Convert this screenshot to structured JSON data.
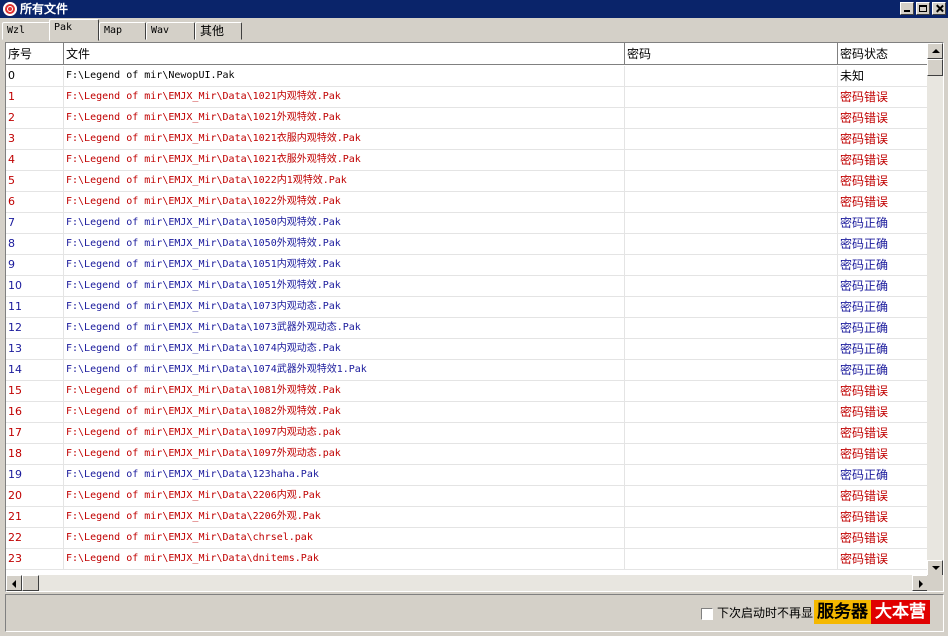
{
  "window": {
    "title": "所有文件"
  },
  "tabs": [
    "Wzl",
    "Pak",
    "Map",
    "Wav",
    "其他"
  ],
  "active_tab": "Pak",
  "table": {
    "columns": [
      "序号",
      "文件",
      "密码",
      "密码状态"
    ],
    "rows": [
      {
        "no": "0",
        "file": "F:\\Legend of mir\\NewopUI.Pak",
        "password": "",
        "status": "未知",
        "color": "black"
      },
      {
        "no": "1",
        "file": "F:\\Legend of mir\\EMJX_Mir\\Data\\1021内观特效.Pak",
        "password": "",
        "status": "密码错误",
        "color": "red"
      },
      {
        "no": "2",
        "file": "F:\\Legend of mir\\EMJX_Mir\\Data\\1021外观特效.Pak",
        "password": "",
        "status": "密码错误",
        "color": "red"
      },
      {
        "no": "3",
        "file": "F:\\Legend of mir\\EMJX_Mir\\Data\\1021衣服内观特效.Pak",
        "password": "",
        "status": "密码错误",
        "color": "red"
      },
      {
        "no": "4",
        "file": "F:\\Legend of mir\\EMJX_Mir\\Data\\1021衣服外观特效.Pak",
        "password": "",
        "status": "密码错误",
        "color": "red"
      },
      {
        "no": "5",
        "file": "F:\\Legend of mir\\EMJX_Mir\\Data\\1022内1观特效.Pak",
        "password": "",
        "status": "密码错误",
        "color": "red"
      },
      {
        "no": "6",
        "file": "F:\\Legend of mir\\EMJX_Mir\\Data\\1022外观特效.Pak",
        "password": "",
        "status": "密码错误",
        "color": "red"
      },
      {
        "no": "7",
        "file": "F:\\Legend of mir\\EMJX_Mir\\Data\\1050内观特效.Pak",
        "password": "",
        "status": "密码正确",
        "color": "blue"
      },
      {
        "no": "8",
        "file": "F:\\Legend of mir\\EMJX_Mir\\Data\\1050外观特效.Pak",
        "password": "",
        "status": "密码正确",
        "color": "blue"
      },
      {
        "no": "9",
        "file": "F:\\Legend of mir\\EMJX_Mir\\Data\\1051内观特效.Pak",
        "password": "",
        "status": "密码正确",
        "color": "blue"
      },
      {
        "no": "10",
        "file": "F:\\Legend of mir\\EMJX_Mir\\Data\\1051外观特效.Pak",
        "password": "",
        "status": "密码正确",
        "color": "blue"
      },
      {
        "no": "11",
        "file": "F:\\Legend of mir\\EMJX_Mir\\Data\\1073内观动态.Pak",
        "password": "",
        "status": "密码正确",
        "color": "blue"
      },
      {
        "no": "12",
        "file": "F:\\Legend of mir\\EMJX_Mir\\Data\\1073武器外观动态.Pak",
        "password": "",
        "status": "密码正确",
        "color": "blue"
      },
      {
        "no": "13",
        "file": "F:\\Legend of mir\\EMJX_Mir\\Data\\1074内观动态.Pak",
        "password": "",
        "status": "密码正确",
        "color": "blue"
      },
      {
        "no": "14",
        "file": "F:\\Legend of mir\\EMJX_Mir\\Data\\1074武器外观特效1.Pak",
        "password": "",
        "status": "密码正确",
        "color": "blue"
      },
      {
        "no": "15",
        "file": "F:\\Legend of mir\\EMJX_Mir\\Data\\1081外观特效.Pak",
        "password": "",
        "status": "密码错误",
        "color": "red"
      },
      {
        "no": "16",
        "file": "F:\\Legend of mir\\EMJX_Mir\\Data\\1082外观特效.Pak",
        "password": "",
        "status": "密码错误",
        "color": "red"
      },
      {
        "no": "17",
        "file": "F:\\Legend of mir\\EMJX_Mir\\Data\\1097内观动态.pak",
        "password": "",
        "status": "密码错误",
        "color": "red"
      },
      {
        "no": "18",
        "file": "F:\\Legend of mir\\EMJX_Mir\\Data\\1097外观动态.pak",
        "password": "",
        "status": "密码错误",
        "color": "red"
      },
      {
        "no": "19",
        "file": "F:\\Legend of mir\\EMJX_Mir\\Data\\123haha.Pak",
        "password": "",
        "status": "密码正确",
        "color": "blue"
      },
      {
        "no": "20",
        "file": "F:\\Legend of mir\\EMJX_Mir\\Data\\2206内观.Pak",
        "password": "",
        "status": "密码错误",
        "color": "red"
      },
      {
        "no": "21",
        "file": "F:\\Legend of mir\\EMJX_Mir\\Data\\2206外观.Pak",
        "password": "",
        "status": "密码错误",
        "color": "red"
      },
      {
        "no": "22",
        "file": "F:\\Legend of mir\\EMJX_Mir\\Data\\chrsel.pak",
        "password": "",
        "status": "密码错误",
        "color": "red"
      },
      {
        "no": "23",
        "file": "F:\\Legend of mir\\EMJX_Mir\\Data\\dnitems.Pak",
        "password": "",
        "status": "密码错误",
        "color": "red"
      }
    ]
  },
  "footer": {
    "checkbox_label": "下次启动时不再显",
    "checkbox_checked": false,
    "watermark": {
      "part1": "服务器",
      "part2": "大本营"
    }
  },
  "colors": {
    "titlebar": "#0a246a",
    "error": "#c00000",
    "ok": "#1a1a9c",
    "unknown": "#000000"
  }
}
